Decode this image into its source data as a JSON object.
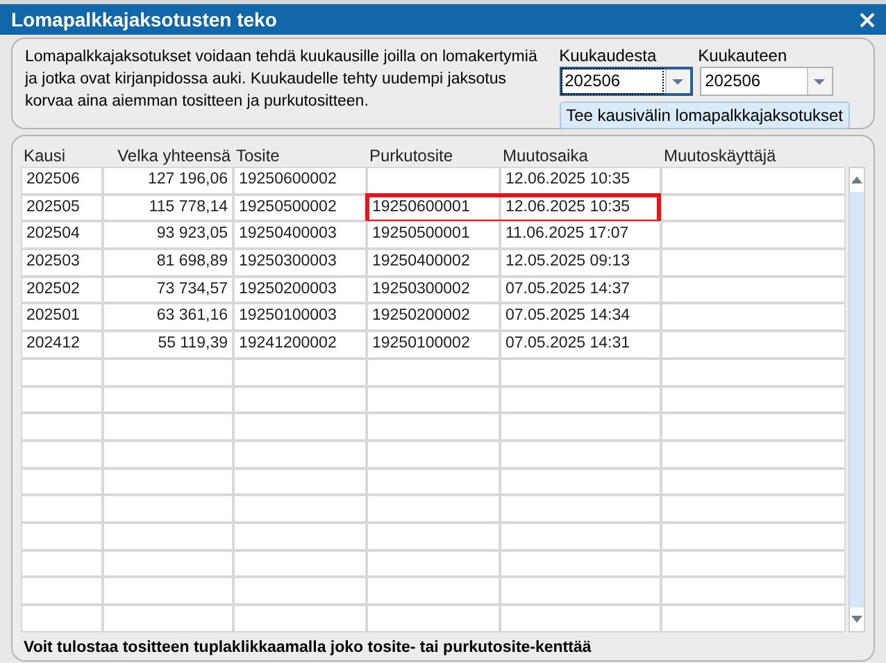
{
  "window": {
    "title": "Lomapalkkajaksotusten teko"
  },
  "info_text": "Lomapalkkajaksotukset voidaan tehdä kuukausille joilla on lomakertymiä ja jotka ovat kirjanpidossa auki. Kuukaudelle tehty uudempi jaksotus korvaa aina aiemman tositteen ja purkutositteen.",
  "range": [
    {
      "label": "Kuukaudesta",
      "value": "202506",
      "focused": true
    },
    {
      "label": "Kuukauteen",
      "value": "202506",
      "focused": false
    }
  ],
  "run_button": "Tee kausivälin lomapalkkajaksotukset",
  "table": {
    "columns": [
      "Kausi",
      "Velka yhteensä",
      "Tosite",
      "Purkutosite",
      "Muutosaika",
      "Muutoskäyttäjä"
    ],
    "rows": [
      {
        "cells": [
          "202506",
          "127 196,06",
          "19250600002",
          "",
          "12.06.2025 10:35",
          ""
        ],
        "highlighted": false
      },
      {
        "cells": [
          "202505",
          "115 778,14",
          "19250500002",
          "19250600001",
          "12.06.2025 10:35",
          ""
        ],
        "highlighted": true
      },
      {
        "cells": [
          "202504",
          "93 923,05",
          "19250400003",
          "19250500001",
          "11.06.2025 17:07",
          ""
        ],
        "highlighted": false
      },
      {
        "cells": [
          "202503",
          "81 698,89",
          "19250300003",
          "19250400002",
          "12.05.2025 09:13",
          ""
        ],
        "highlighted": false
      },
      {
        "cells": [
          "202502",
          "73 734,57",
          "19250200003",
          "19250300002",
          "07.05.2025 14:37",
          ""
        ],
        "highlighted": false
      },
      {
        "cells": [
          "202501",
          "63 361,16",
          "19250100003",
          "19250200002",
          "07.05.2025 14:34",
          ""
        ],
        "highlighted": false
      },
      {
        "cells": [
          "202412",
          "55 119,39",
          "19241200002",
          "19250100002",
          "07.05.2025 14:31",
          ""
        ],
        "highlighted": false
      }
    ]
  },
  "footer_text": "Voit tulostaa tositteen tuplaklikkaamalla joko tosite- tai purkutosite-kenttää"
}
